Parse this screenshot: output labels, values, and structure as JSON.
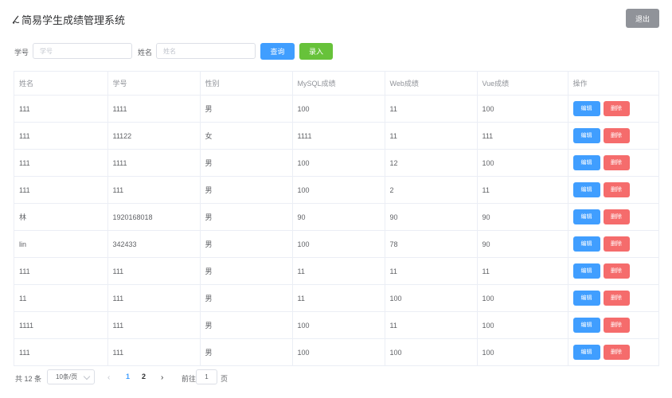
{
  "header": {
    "title": "简易学生成绩管理系统",
    "logout_label": "退出"
  },
  "search": {
    "student_no_label": "学号",
    "student_no_placeholder": "学号",
    "name_label": "姓名",
    "name_placeholder": "姓名",
    "query_label": "查询",
    "add_label": "录入"
  },
  "table": {
    "columns": [
      "姓名",
      "学号",
      "性别",
      "MySQL成绩",
      "Web成绩",
      "Vue成绩",
      "操作"
    ],
    "edit_label": "编辑",
    "delete_label": "删除",
    "rows": [
      [
        "111",
        "1111",
        "男",
        "100",
        "11",
        "100"
      ],
      [
        "111",
        "11122",
        "女",
        "1111",
        "11",
        "111"
      ],
      [
        "111",
        "1111",
        "男",
        "100",
        "12",
        "100"
      ],
      [
        "111",
        "111",
        "男",
        "100",
        "2",
        "11"
      ],
      [
        "林",
        "1920168018",
        "男",
        "90",
        "90",
        "90"
      ],
      [
        "lin",
        "342433",
        "男",
        "100",
        "78",
        "90"
      ],
      [
        "111",
        "111",
        "男",
        "11",
        "11",
        "11"
      ],
      [
        "11",
        "111",
        "男",
        "11",
        "100",
        "100"
      ],
      [
        "1111",
        "111",
        "男",
        "100",
        "11",
        "100"
      ],
      [
        "111",
        "111",
        "男",
        "100",
        "100",
        "100"
      ]
    ]
  },
  "pagination": {
    "total_text": "共 12 条",
    "page_size": "10条/页",
    "prev_icon": "‹",
    "pages": [
      "1",
      "2"
    ],
    "current_page": "1",
    "next_icon": "›",
    "goto_label": "前往",
    "goto_value": "1",
    "goto_unit": "页"
  },
  "colors": {
    "primary": "#409eff",
    "success": "#67c23a",
    "danger": "#f56c6c",
    "info": "#909399"
  }
}
